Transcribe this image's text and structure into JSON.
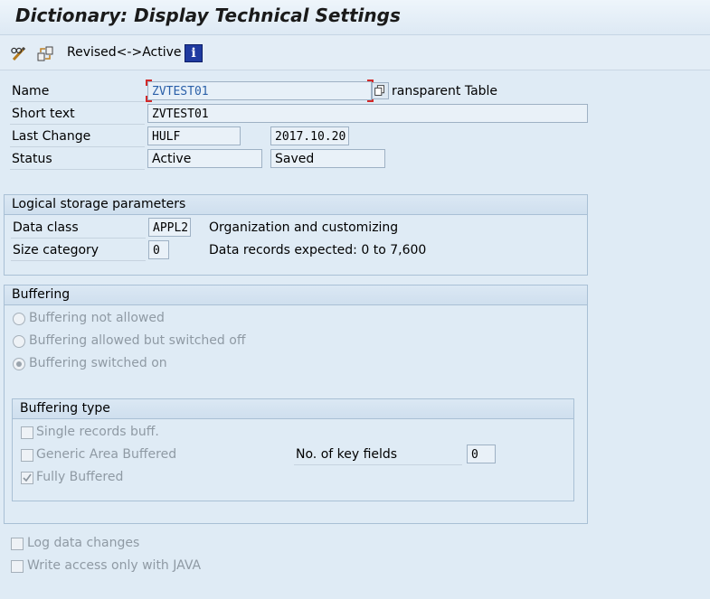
{
  "window": {
    "title": "Dictionary: Display Technical Settings"
  },
  "toolbar": {
    "edit_icon": "pencil-glasses-icon",
    "switch_icon": "display-change-icon",
    "revised_active_label": "Revised<->Active",
    "info_icon": "info-icon",
    "info_glyph": "i"
  },
  "header": {
    "name_label": "Name",
    "name_value": "ZVTEST01",
    "table_type": "ransparent Table",
    "short_text_label": "Short text",
    "short_text_value": "ZVTEST01",
    "last_change_label": "Last Change",
    "last_change_user": "HULF",
    "last_change_date": "2017.10.20",
    "status_label": "Status",
    "status_value": "Active",
    "status_saved": "Saved"
  },
  "logical_storage": {
    "title": "Logical storage parameters",
    "data_class_label": "Data class",
    "data_class_value": "APPL2",
    "data_class_desc": "Organization and customizing",
    "size_category_label": "Size category",
    "size_category_value": "0",
    "size_category_desc": "Data records expected: 0 to 7,600"
  },
  "buffering": {
    "title": "Buffering",
    "options": [
      {
        "label": "Buffering not allowed",
        "selected": false
      },
      {
        "label": "Buffering allowed but switched off",
        "selected": false
      },
      {
        "label": "Buffering switched on",
        "selected": true
      }
    ],
    "type": {
      "title": "Buffering type",
      "single_records": {
        "label": "Single records buff.",
        "checked": false
      },
      "generic_area": {
        "label": "Generic Area Buffered",
        "checked": false
      },
      "fully_buffered": {
        "label": "Fully Buffered",
        "checked": true
      },
      "key_fields_label": "No. of key fields",
      "key_fields_value": "0"
    }
  },
  "footer": {
    "log_changes": {
      "label": "Log data changes",
      "checked": false
    },
    "java_only": {
      "label": "Write access only with JAVA",
      "checked": false
    }
  },
  "colors": {
    "field_bg": "#e7f0f8",
    "panel_bg": "#dfebf5",
    "focus_red": "#d22a2a",
    "info_blue": "#1f3aa0"
  }
}
